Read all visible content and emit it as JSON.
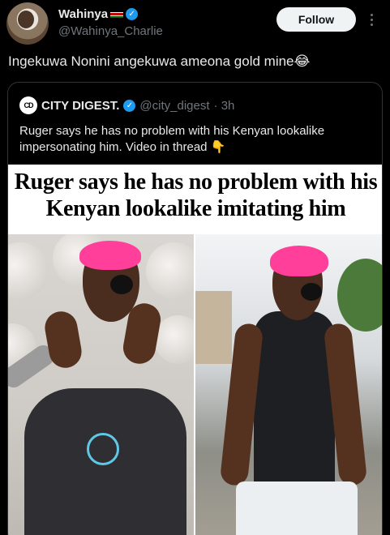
{
  "post": {
    "author": {
      "display_name": "Wahinya",
      "handle": "@Wahinya_Charlie",
      "verified_icon": "✓"
    },
    "follow_label": "Follow",
    "text": "Ingekuwa Nonini angekuwa ameona gold mine😂"
  },
  "quote": {
    "avatar_text": "CD",
    "name": "CITY DIGEST.",
    "handle": "@city_digest",
    "time": "· 3h",
    "verified_icon": "✓",
    "text": "Ruger says he has no problem with his Kenyan lookalike impersonating him. Video in thread 👇",
    "image_headline": "Ruger says he has no problem with his Kenyan lookalike imitating him"
  },
  "colors": {
    "background": "#000000",
    "follow_bg": "#eff3f4",
    "verified": "#1d9bf0",
    "muted": "#71767b",
    "hair_pink": "#ff3f9a"
  },
  "icons": {
    "more": "more-icon",
    "verified": "verified-badge-icon",
    "flag": "kenya-flag-icon"
  }
}
